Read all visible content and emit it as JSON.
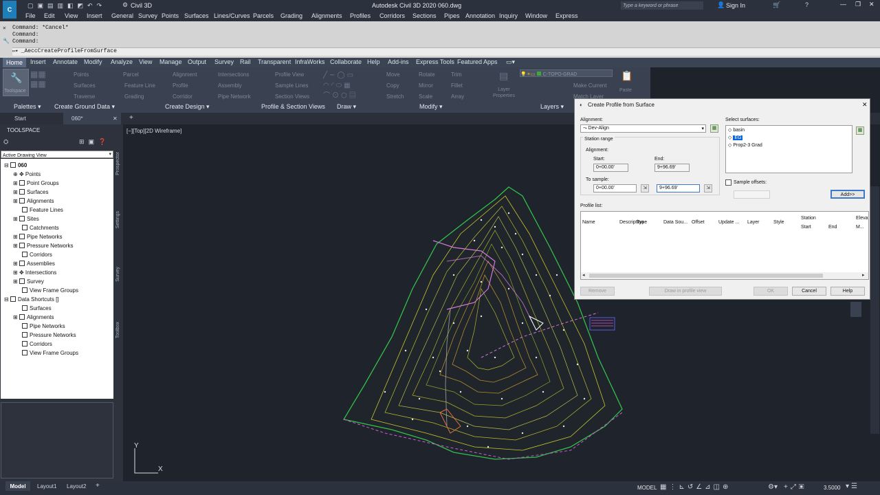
{
  "titlebar": {
    "app": "Civil 3D",
    "title": "Autodesk Civil 3D 2020   060.dwg",
    "search_placeholder": "Type a keyword or phrase",
    "signin": "Sign In"
  },
  "menu": [
    "File",
    "Edit",
    "View",
    "Insert",
    "General",
    "Survey",
    "Points",
    "Surfaces",
    "Lines/Curves",
    "Parcels",
    "Grading",
    "Alignments",
    "Profiles",
    "Corridors",
    "Sections",
    "Pipes",
    "Annotation",
    "Inquiry",
    "Window",
    "Express"
  ],
  "command": {
    "lines": [
      "Command: *Cancel*",
      "Command:",
      "Command:"
    ],
    "current": "_AeccCreateProfileFromSurface"
  },
  "ribbon_tabs": [
    "Home",
    "Insert",
    "Annotate",
    "Modify",
    "Analyze",
    "View",
    "Manage",
    "Output",
    "Survey",
    "Rail",
    "Transparent",
    "InfraWorks",
    "Collaborate",
    "Help",
    "Add-ins",
    "Express Tools",
    "Featured Apps"
  ],
  "ribbon": {
    "toolspace": "Toolspace",
    "ground": [
      "Points",
      "Surfaces",
      "Traverse"
    ],
    "design": [
      "Parcel",
      "Feature Line",
      "Grading",
      "Alignment",
      "Profile",
      "Corridor",
      "Intersections",
      "Assembly",
      "Pipe Network"
    ],
    "profile": [
      "Profile View",
      "Sample Lines",
      "Section Views"
    ],
    "modify": [
      "Move",
      "Copy",
      "Stretch",
      "Rotate",
      "Mirror",
      "Scale",
      "Trim",
      "Fillet",
      "Array"
    ],
    "layers": {
      "layer_name": "C-TOPO-GRAD",
      "layer_properties": "Layer Properties",
      "make_current": "Make Current",
      "match_layer": "Match Layer"
    },
    "paste": "Paste",
    "panels": [
      "Palettes",
      "Create Ground Data",
      "Create Design",
      "Profile & Section Views",
      "Draw",
      "Modify",
      "Layers"
    ]
  },
  "doc_tabs": [
    "Start",
    "060*"
  ],
  "toolspace": {
    "title": "TOOLSPACE",
    "view": "Active Drawing View",
    "side_tabs": [
      "Prospector",
      "Settings",
      "Survey",
      "Toolbox"
    ],
    "tree": [
      "060",
      "Points",
      "Point Groups",
      "Surfaces",
      "Alignments",
      "Feature Lines",
      "Sites",
      "Catchments",
      "Pipe Networks",
      "Pressure Networks",
      "Corridors",
      "Assemblies",
      "Intersections",
      "Survey",
      "View Frame Groups",
      "Data Shortcuts []",
      "Surfaces",
      "Alignments",
      "Pipe Networks",
      "Pressure Networks",
      "Corridors",
      "View Frame Groups"
    ]
  },
  "viewport": {
    "label": "[−][Top][2D Wireframe]",
    "y": "Y",
    "x": "X"
  },
  "dialog": {
    "title": "Create Profile from Surface",
    "alignment_label": "Alignment:",
    "alignment_value": "Dev-Align",
    "station_range": "Station range",
    "alignment_sub": "Alignment:",
    "start_label": "Start:",
    "start_value": "0+00.00'",
    "end_label": "End:",
    "end_value": "9+96.69'",
    "to_sample": "To sample:",
    "sample_start": "0+00.00'",
    "sample_end": "9+96.69'",
    "select_surfaces": "Select surfaces:",
    "surfaces": [
      "basin",
      "EG",
      "Prop2-3 Grad"
    ],
    "sample_offsets": "Sample offsets:",
    "add_button": "Add>>",
    "profile_list": "Profile list:",
    "columns": [
      "Name",
      "Description",
      "Type",
      "Data Sou...",
      "Offset",
      "Update ...",
      "Layer",
      "Style",
      "Station",
      "Start",
      "End",
      "Eleva",
      "M..."
    ],
    "buttons": {
      "remove": "Remove",
      "draw": "Draw in profile view",
      "ok": "OK",
      "cancel": "Cancel",
      "help": "Help"
    }
  },
  "status": {
    "tabs": [
      "Model",
      "Layout1",
      "Layout2"
    ],
    "model": "MODEL",
    "scale": "3.5000"
  }
}
